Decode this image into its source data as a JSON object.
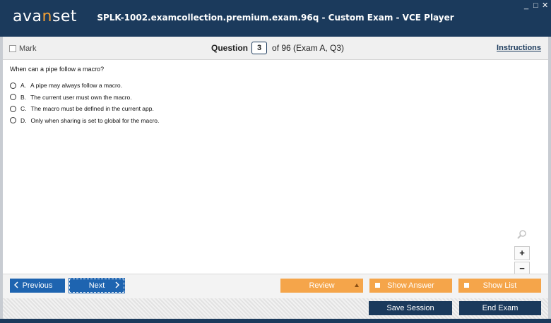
{
  "window": {
    "logo_pre": "ava",
    "logo_accent": "n",
    "logo_post": "set",
    "title": "SPLK-1002.examcollection.premium.exam.96q - Custom Exam - VCE Player",
    "minimize": "_",
    "maximize": "□",
    "close": "✕"
  },
  "subbar": {
    "mark_label": "Mark",
    "question_label": "Question",
    "question_number": "3",
    "question_of": "of 96 (Exam A, Q3)",
    "instructions_label": "Instructions"
  },
  "question": {
    "text": "When can a pipe follow a macro?",
    "options": [
      {
        "letter": "A.",
        "text": "A pipe may always follow a macro."
      },
      {
        "letter": "B.",
        "text": "The current user must own the macro."
      },
      {
        "letter": "C.",
        "text": "The macro must be defined in the current app."
      },
      {
        "letter": "D.",
        "text": "Only when sharing is set to global for the macro."
      }
    ]
  },
  "zoom": {
    "plus": "+",
    "minus": "−"
  },
  "nav": {
    "previous": "Previous",
    "next": "Next",
    "review": "Review",
    "show_answer": "Show Answer",
    "show_list": "Show List",
    "save_session": "Save Session",
    "end_exam": "End Exam"
  },
  "colors": {
    "brand_dark": "#1b3a5c",
    "nav_blue": "#1e64b0",
    "accent_orange": "#f5a54a",
    "logo_accent": "#f5a033"
  },
  "icons": [
    "magnifier-icon",
    "chevron-left-icon",
    "chevron-right-icon",
    "triangle-up-icon"
  ]
}
